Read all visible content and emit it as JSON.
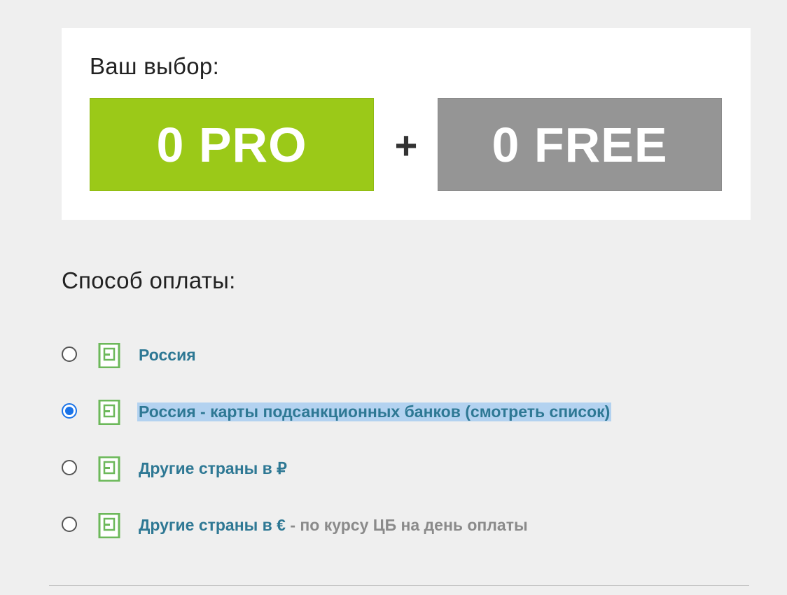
{
  "choice": {
    "title": "Ваш выбор:",
    "pro_label": "0 PRO",
    "plus": "+",
    "free_label": "0 FREE"
  },
  "payment": {
    "title": "Способ оплаты:",
    "options": [
      {
        "label": "Россия",
        "note": "",
        "selected": false
      },
      {
        "label": "Россия - карты подсанкционных банков (смотреть список)",
        "note": "",
        "selected": true
      },
      {
        "label": "Другие страны в ₽",
        "note": "",
        "selected": false
      },
      {
        "label": "Другие страны в €",
        "note": " - по курсу ЦБ на день оплаты",
        "selected": false
      }
    ],
    "icon": "payment-terminal-icon"
  },
  "colors": {
    "pro": "#9bc918",
    "free": "#959595",
    "link": "#2e7894",
    "icon": "#6cb85a",
    "radio_checked": "#1a73e8",
    "selection_highlight": "#b3d2f0"
  }
}
